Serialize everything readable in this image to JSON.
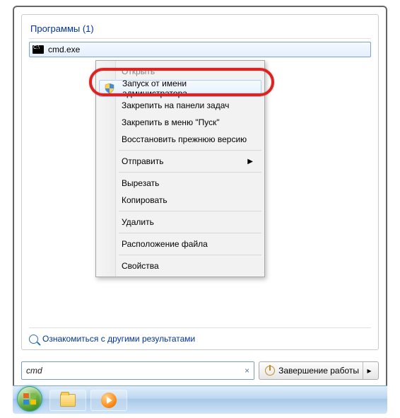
{
  "section_header": "Программы (1)",
  "result": {
    "name": "cmd.exe"
  },
  "more_results": "Ознакомиться с другими результатами",
  "search": {
    "value": "cmd",
    "clear": "×"
  },
  "shutdown": {
    "label": "Завершение работы",
    "arrow": "▸"
  },
  "context_menu": {
    "open": "Открыть",
    "run_admin": "Запуск от имени администратора",
    "pin_taskbar": "Закрепить на панели задач",
    "pin_start": "Закрепить в меню \"Пуск\"",
    "restore": "Восстановить прежнюю версию",
    "send_to": "Отправить",
    "cut": "Вырезать",
    "copy": "Копировать",
    "delete": "Удалить",
    "file_location": "Расположение файла",
    "properties": "Свойства",
    "submenu_arrow": "▶"
  }
}
